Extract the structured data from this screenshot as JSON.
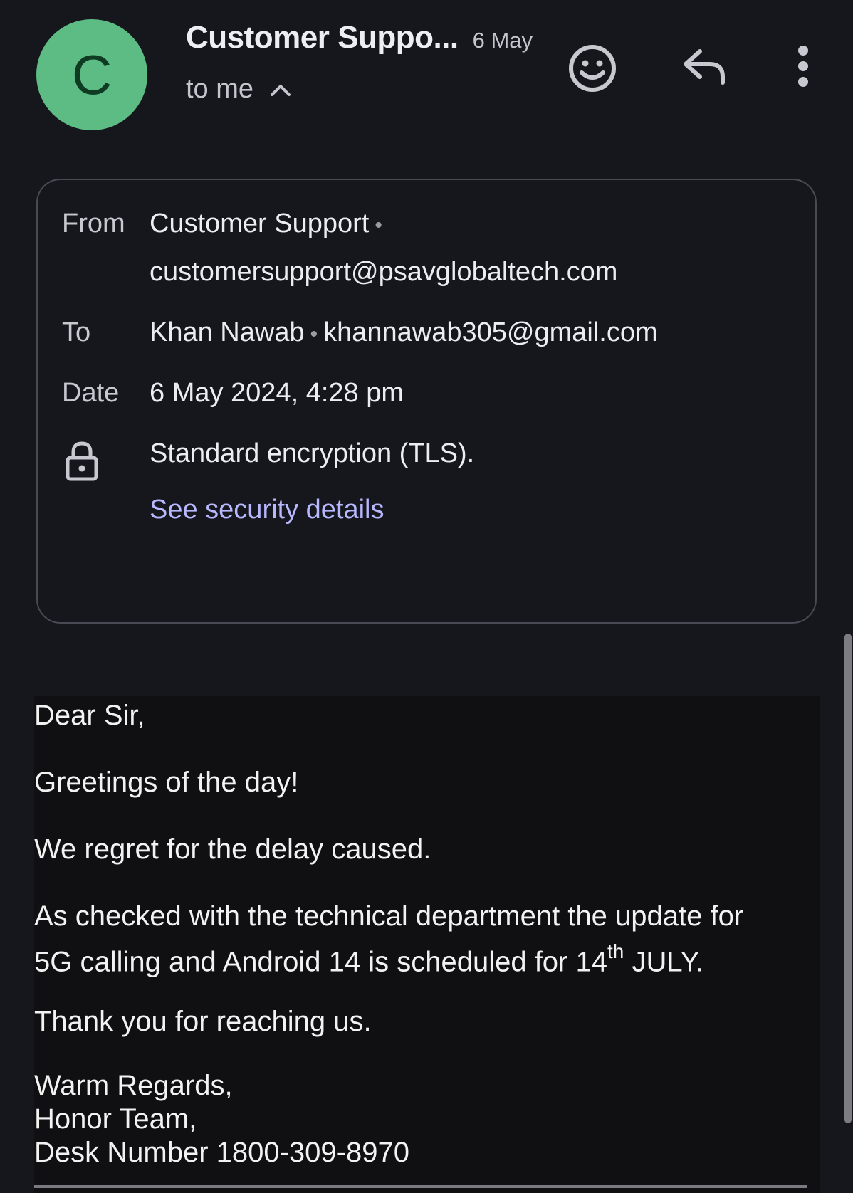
{
  "header": {
    "avatar_letter": "C",
    "sender_name": "Customer Suppo...",
    "date_short": "6 May",
    "recipient_summary": "to me",
    "icons": [
      "add-reaction-icon",
      "reply-icon",
      "more-vert-icon",
      "chevron-up-icon"
    ]
  },
  "details": {
    "from_label": "From",
    "from_name": "Customer Support",
    "from_email": "customersupport@psavglobaltech.com",
    "to_label": "To",
    "to_name": "Khan Nawab",
    "to_email": "khannawab305@gmail.com",
    "date_label": "Date",
    "date_value": "6 May 2024, 4:28 pm",
    "encryption_text": "Standard encryption (TLS).",
    "security_link": "See security details",
    "separator": "•"
  },
  "body": {
    "greeting": "Dear Sir,",
    "line1": "Greetings of the day!",
    "line2": "We regret for the delay caused.",
    "line3a": "As checked with the technical department the update for",
    "line3b_pre": "5G calling and Android 14 is scheduled for 14",
    "line3b_sup": "th",
    "line3b_post": " JULY.",
    "line4": "Thank you for reaching us.",
    "sig1": "Warm Regards,",
    "sig2": "Honor Team,",
    "sig3": "Desk Number 1800-309-8970"
  },
  "colors": {
    "background": "#16161d",
    "avatar": "#5dbb84",
    "link": "#b8b8ff",
    "body_background": "#101012"
  }
}
